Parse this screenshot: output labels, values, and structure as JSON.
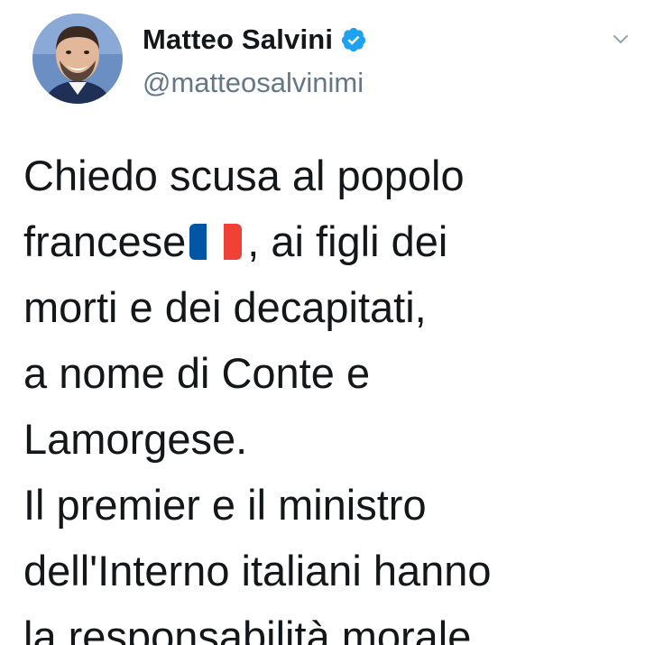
{
  "author": {
    "display_name": "Matteo Salvini",
    "handle": "@matteosalvinimi",
    "verified": true
  },
  "icons": {
    "verified": "verified-check-icon",
    "menu": "chevron-down-icon",
    "flag": "france-flag-emoji"
  },
  "colors": {
    "verified_blue": "#1da1f2",
    "handle_gray": "#657786",
    "text": "#14171a"
  },
  "tweet": {
    "lines": [
      "Chiedo scusa al popolo",
      "francese",
      ", ai figli dei",
      "morti e dei decapitati,",
      "a nome di Conte e",
      "Lamorgese.",
      "Il premier e il ministro",
      "dell'Interno italiani hanno",
      "la responsabilità morale"
    ]
  }
}
